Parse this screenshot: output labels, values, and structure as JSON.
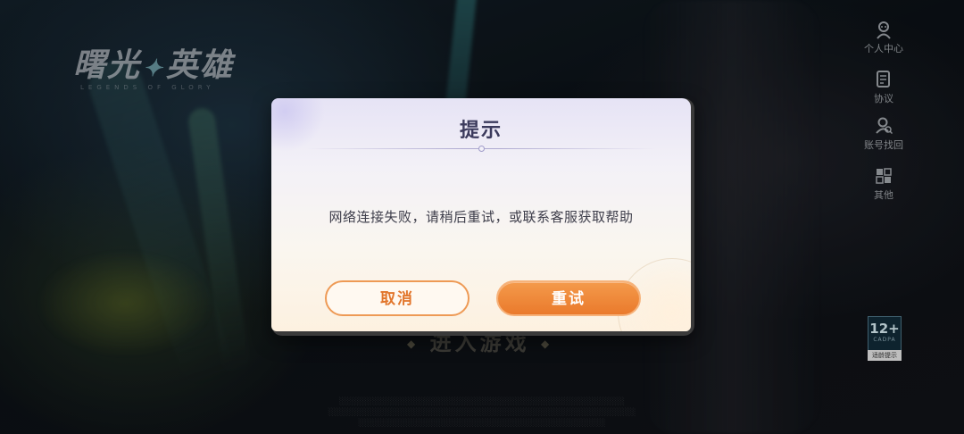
{
  "game": {
    "logo_title_left": "曙光",
    "logo_title_right": "英雄",
    "logo_subtitle": "LEGENDS OF GLORY",
    "enter_game_label": "进入游戏"
  },
  "sidebar": {
    "items": [
      {
        "label": "个人中心",
        "icon": "user-center-icon"
      },
      {
        "label": "协议",
        "icon": "agreement-icon"
      },
      {
        "label": "账号找回",
        "icon": "account-recovery-icon"
      },
      {
        "label": "其他",
        "icon": "grid-icon"
      }
    ]
  },
  "age_rating": {
    "age": "12+",
    "org": "CADPA",
    "tip": "适龄提示"
  },
  "dialog": {
    "title": "提示",
    "message": "网络连接失败，请稍后重试，或联系客服获取帮助",
    "cancel_label": "取消",
    "retry_label": "重试"
  },
  "colors": {
    "accent_orange": "#ea7a2c",
    "title_color": "#3b3a5c",
    "cancel_border": "#ee9a55"
  }
}
